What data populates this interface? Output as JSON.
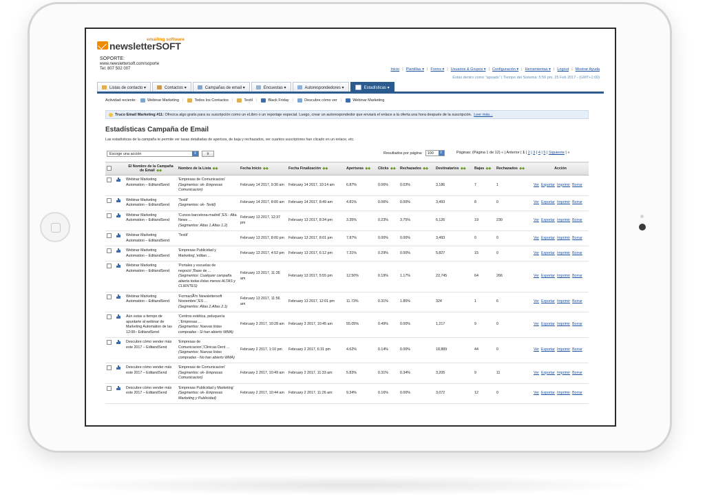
{
  "logo": {
    "tagline": "emailing software",
    "word_main": "newsletter",
    "word_accent": "SOFT"
  },
  "support": {
    "label": "SOPORTE:",
    "url": "www.newslettersoft.com/soporte",
    "phone": "Tel: 807 502 007"
  },
  "topnav": {
    "items": [
      {
        "label": "Inicio"
      },
      {
        "label": "Plantillas ▾"
      },
      {
        "label": "Forms ▾"
      },
      {
        "label": "Usuarios & Grupos ▾"
      },
      {
        "label": "Configuración ▾"
      },
      {
        "label": "Herramientas ▾"
      },
      {
        "label": "Logout"
      },
      {
        "label": "Mostrar Ayuda"
      }
    ],
    "system_line": "Estás dentro como \"apoads\" | Tiempo del Sistema: 5:56 pm, 25 Feb 2017 - (GMT+1:00)"
  },
  "tabs": [
    {
      "label": "Listas de contacto ▾",
      "color": "#e0b050"
    },
    {
      "label": "Contactos ▾",
      "color": "#c89a4a"
    },
    {
      "label": "Campañas de email ▾",
      "color": "#7fa6d0"
    },
    {
      "label": "Encuestas ▾",
      "color": "#9ab0c8"
    },
    {
      "label": "Autorespondedores ▾",
      "color": "#8fb0d8"
    },
    {
      "label": "Estadísticas ▾",
      "color": "#ffffff"
    }
  ],
  "recent": {
    "label": "Actividad reciente:",
    "items": [
      {
        "label": "Webinar Marketing",
        "color": "#7fa6d0"
      },
      {
        "label": "Todos los Contactos",
        "color": "#e0b050"
      },
      {
        "label": "Textil",
        "color": "#e0b050"
      },
      {
        "label": "Black Friday",
        "color": "#3a6cb0"
      },
      {
        "label": "Descubre cómo ver",
        "color": "#7fa6d0"
      },
      {
        "label": "Webinar Marketing",
        "color": "#3a6cb0"
      }
    ]
  },
  "tip": {
    "bold": "Truco Email Marketing #11:",
    "text": "Ofrezca algo gratis para su suscripción como un eLibro o un reportaje especial. Luego, crear un autorespondedor que enviará el enlace a la oferta una hora después de la suscripción.",
    "link": "Leer más..."
  },
  "page": {
    "title": "Estadísticas Campaña de Email",
    "description": "Las estadísticas de la campaña te permite ver tasas detalladas de apertura, de baja y rechazados, ver cuantos suscriptores han clicado en un enlace, etc."
  },
  "controls": {
    "action_select": "Escoge una acción",
    "go": "Ir",
    "per_page_label": "Resultados por página:",
    "per_page_value": "100",
    "pages_label": "Páginas: (Página 1 de 12)",
    "pages_prev": "« | Anterior |",
    "pages_current": "1",
    "pages_links": [
      "2",
      "3",
      "4",
      "5"
    ],
    "pages_next": "Siguiente",
    "pages_end": "»"
  },
  "table": {
    "headers": [
      "El Nombre de la Campaña de Email",
      "Nombre de la Lista",
      "Fecha Inicio",
      "Fecha Finalización",
      "Aperturas",
      "Clicks",
      "Rechazados",
      "Destinatarios",
      "Bajas",
      "Rechazados",
      "Acción"
    ],
    "actions": [
      "Ver",
      "Exportar",
      "Imprimir",
      "Borrar"
    ],
    "rows": [
      {
        "campaign": "Webinar Marketing Automation – EditandSend",
        "list": "'Empresas de Comunicacion'",
        "segment": "(Segmentos: ok- Empresas Comunicacion)",
        "start": "February 14 2017, 9:30 am",
        "end": "February 14 2017, 10:14 am",
        "opens": "6.87%",
        "clicks": "0.06%",
        "bounces": "0.03%",
        "recipients": "3,186",
        "unsubs": "7",
        "rejected": "1"
      },
      {
        "campaign": "Webinar Marketing Automation – EditandSend",
        "list": "'Textil'",
        "segment": "(Segmentos: ok- Textil)",
        "start": "February 14 2017, 8:00 am",
        "end": "February 14 2017, 8:49 am",
        "opens": "4.81%",
        "clicks": "0.06%",
        "bounces": "0.00%",
        "recipients": "3,493",
        "unsubs": "8",
        "rejected": "0"
      },
      {
        "campaign": "Webinar Marketing Automation – EditandSend",
        "list": "'Cursos barcelona-madrid','ES - Alta News ...",
        "segment": "(Segmentos: Altas 1,Altas 1.2)",
        "start": "February 13 2017, 12:37 pm",
        "end": "February 13 2017, 8:34 pm",
        "opens": "3.35%",
        "clicks": "0.23%",
        "bounces": "3.75%",
        "recipients": "6,126",
        "unsubs": "19",
        "rejected": "230"
      },
      {
        "campaign": "Webinar Marketing Automation – EditandSend",
        "list": "'Textil'",
        "segment": "",
        "start": "February 13 2017, 8:00 pm",
        "end": "February 13 2017, 8:01 pm",
        "opens": "7.87%",
        "clicks": "0.00%",
        "bounces": "0.00%",
        "recipients": "3,493",
        "unsubs": "0",
        "rejected": "0"
      },
      {
        "campaign": "Webinar Marketing Automation – EditandSend",
        "list": "'Empresas Publicidad y Marketing','editan ...",
        "segment": "",
        "start": "February 13 2017, 4:52 pm",
        "end": "February 13 2017, 6:12 pm",
        "opens": "7.31%",
        "clicks": "0.29%",
        "bounces": "0.00%",
        "recipients": "5,827",
        "unsubs": "15",
        "rejected": "0"
      },
      {
        "campaign": "Webinar Marketing Automation – EditandSend",
        "list": "'Portales y escuelas de negocio','Base de ...",
        "segment": "(Segmentos: Cualquier campaña abierta todas listas menos ALTAS y CLIENTES)",
        "start": "February 13 2017, 11:35 am",
        "end": "February 13 2017, 5:55 pm",
        "opens": "12.50%",
        "clicks": "0.19%",
        "bounces": "1.17%",
        "recipients": "22,745",
        "unsubs": "64",
        "rejected": "266"
      },
      {
        "campaign": "Webinar Marketing Automation – EditandSend",
        "list": "'FormaciÃ³n Newslettersoft Noviembre','ES ...",
        "segment": "(Segmentos: Altas 2,Altas 2.1)",
        "start": "February 13 2017, 11:56 am",
        "end": "February 13 2017, 12:01 pm",
        "opens": "11.73%",
        "clicks": "0.31%",
        "bounces": "1.85%",
        "recipients": "324",
        "unsubs": "1",
        "rejected": "6"
      },
      {
        "campaign": "Aún estas a tiempo de apuntarte al webinar de Marketing Automation de las 12:00– EditandSend",
        "list": "'Centros estética, peluquería ','Empresas ...",
        "segment": "(Segmentos: Nuevas listas compradas - Si han abierto WMA)",
        "start": "February 3 2017, 10:28 am",
        "end": "February 3 2017, 10:45 am",
        "opens": "55.05%",
        "clicks": "0.49%",
        "bounces": "0.00%",
        "recipients": "1,217",
        "unsubs": "9",
        "rejected": "0"
      },
      {
        "campaign": "Descubre cómo vender más este 2017 – EditandSend",
        "list": "'Empresas de Comunicacion','Clinicas Dent ...",
        "segment": "(Segmentos: Nuevas listas compradas - No han abierto WMA)",
        "start": "February 2 2017, 1:10 pm",
        "end": "February 2 2017, 6:31 pm",
        "opens": "4.62%",
        "clicks": "0.14%",
        "bounces": "0.00%",
        "recipients": "18,889",
        "unsubs": "44",
        "rejected": "0"
      },
      {
        "campaign": "Descubre cómo vender más este 2017 – EditandSend",
        "list": "'Empresas de Comunicacion'",
        "segment": "(Segmentos: ok- Empresas Comunicacion)",
        "start": "February 2 2017, 10:49 am",
        "end": "February 2 2017, 11:33 am",
        "opens": "5.83%",
        "clicks": "0.31%",
        "bounces": "0.34%",
        "recipients": "3,205",
        "unsubs": "9",
        "rejected": "11"
      },
      {
        "campaign": "Descubre cómo vender más este 2017 – EditandSend",
        "list": "'Empresas Publicidad y Marketing'",
        "segment": "(Segmentos: ok- Empresas Marketing y Publicidad)",
        "start": "February 2 2017, 10:44 am",
        "end": "February 2 2017, 11:26 am",
        "opens": "9.34%",
        "clicks": "0.16%",
        "bounces": "0.00%",
        "recipients": "3,072",
        "unsubs": "12",
        "rejected": "0"
      }
    ]
  }
}
